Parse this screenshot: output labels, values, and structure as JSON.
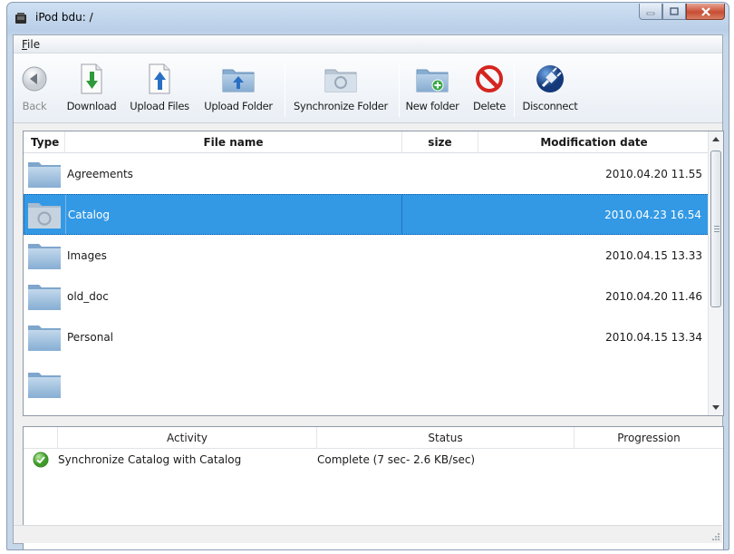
{
  "window": {
    "title": "iPod bdu: /"
  },
  "menu": {
    "file_label": "File",
    "file_mnemonic": "F",
    "file_rest": "ile"
  },
  "toolbar": {
    "back": "Back",
    "download": "Download",
    "upload_files": "Upload Files",
    "upload_folder": "Upload Folder",
    "synchronize_folder": "Synchronize Folder",
    "new_folder": "New folder",
    "delete": "Delete",
    "disconnect": "Disconnect"
  },
  "file_list": {
    "columns": {
      "type": "Type",
      "name": "File name",
      "size": "size",
      "date": "Modification date"
    },
    "rows": [
      {
        "name": "Agreements",
        "size": "",
        "date": "2010.04.20 11.55",
        "icon": "folder-icon"
      },
      {
        "name": "Catalog",
        "size": "",
        "date": "2010.04.23 16.54",
        "icon": "sync-folder-icon",
        "selected": true
      },
      {
        "name": "Images",
        "size": "",
        "date": "2010.04.15 13.33",
        "icon": "folder-icon"
      },
      {
        "name": "old_doc",
        "size": "",
        "date": "2010.04.20 11.46",
        "icon": "folder-icon"
      },
      {
        "name": "Personal",
        "size": "",
        "date": "2010.04.15 13.34",
        "icon": "folder-icon"
      }
    ]
  },
  "activity": {
    "columns": {
      "activity": "Activity",
      "status": "Status",
      "progression": "Progression"
    },
    "rows": [
      {
        "activity": "Synchronize Catalog with Catalog",
        "status": "Complete (7 sec- 2.6 KB/sec)",
        "progression": "",
        "icon": "check-circle-icon"
      }
    ]
  },
  "colors": {
    "selection": "#3399e5",
    "folder": "#8fb4d6"
  }
}
